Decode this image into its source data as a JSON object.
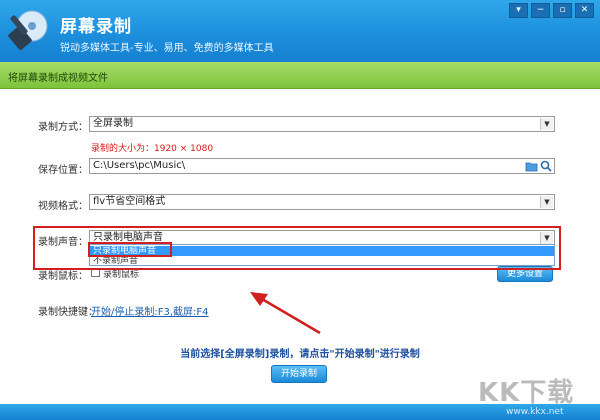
{
  "app": {
    "title": "屏幕录制",
    "subtitle": "锐动多媒体工具-专业、易用、免费的多媒体工具"
  },
  "window_buttons": [
    "▾",
    "−",
    "▫",
    "✕"
  ],
  "banner": "将屏幕录制成视频文件",
  "fields": {
    "mode_label": "录制方式：",
    "mode_value": "全屏录制",
    "size_hint": "录制的大小为：1920 × 1080",
    "save_label": "保存位置：",
    "save_value": "C:\\Users\\pc\\Music\\",
    "format_label": "视频格式：",
    "format_value": "flv节省空间格式",
    "audio_label": "录制声音：",
    "audio_value": "只录制电脑声音",
    "audio_options": [
      "只录制电脑声音",
      "不录制声音"
    ],
    "cursor_label": "录制鼠标：",
    "cursor_checkbox": "录制鼠标",
    "more_button": "更多设置",
    "hotkey_label": "录制快捷键：",
    "hotkey_value": "开始/停止录制:F3,截屏:F4"
  },
  "status": "当前选择[全屏录制]录制，请点击\"开始录制\"进行录制",
  "start_button": "开始录制",
  "watermark": {
    "logo": "KK下载",
    "url": "www.kkx.net"
  },
  "colors": {
    "title_blue": "#1d8fdd",
    "banner_green": "#7dc23c",
    "highlight_red": "#d02020",
    "selection_blue": "#3399ff"
  }
}
